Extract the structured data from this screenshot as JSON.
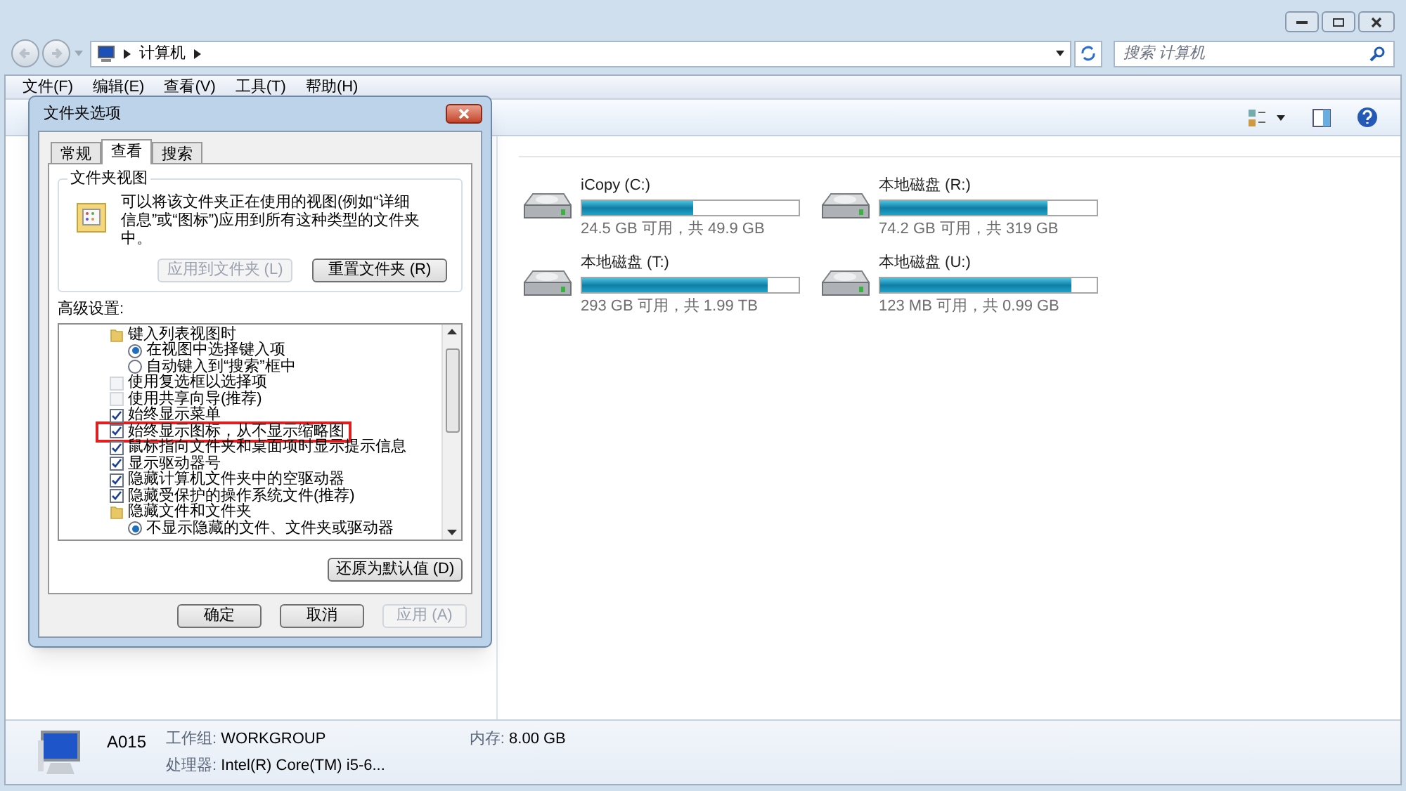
{
  "explorer": {
    "address": {
      "path": [
        "计算机"
      ]
    },
    "search": {
      "placeholder": "搜索 计算机"
    },
    "menu": [
      "文件(F)",
      "编辑(E)",
      "查看(V)",
      "工具(T)",
      "帮助(H)"
    ],
    "drives": [
      {
        "name": "iCopy (C:)",
        "level": 0.51,
        "reading": "24.5 GB 可用，共 49.9 GB"
      },
      {
        "name": "本地磁盘 (R:)",
        "level": 0.77,
        "reading": "74.2 GB 可用，共 319 GB"
      },
      {
        "name": "本地磁盘 (T:)",
        "level": 0.86,
        "reading": "293 GB 可用，共 1.99 TB"
      },
      {
        "name": "本地磁盘 (U:)",
        "level": 0.88,
        "reading": "123 MB 可用，共 0.99 GB"
      }
    ],
    "details": {
      "computer_name": "A015",
      "fields": [
        {
          "label": "工作组:",
          "value": "WORKGROUP"
        },
        {
          "label": "内存:",
          "value": "8.00 GB"
        },
        {
          "label": "处理器:",
          "value": "Intel(R) Core(TM) i5-6..."
        }
      ]
    }
  },
  "dialog": {
    "title": "文件夹选项",
    "tabs": [
      {
        "label": "常规",
        "selected": false
      },
      {
        "label": "查看",
        "selected": true
      },
      {
        "label": "搜索",
        "selected": false
      }
    ],
    "folder_views": {
      "title": "文件夹视图",
      "description": "可以将该文件夹正在使用的视图(例如“详细信息”或“图标”)应用到所有这种类型的文件夹中。",
      "buttons": [
        {
          "label": "应用到文件夹 (L)",
          "disabled": true
        },
        {
          "label": "重置文件夹 (R)",
          "disabled": false
        }
      ]
    },
    "advanced_label": "高级设置:",
    "settings": [
      {
        "kind": "folder",
        "label": "键入列表视图时",
        "children": [
          {
            "kind": "radio",
            "label": "在视图中选择键入项",
            "selected": true
          },
          {
            "kind": "radio",
            "label": "自动键入到“搜索”框中",
            "selected": false
          }
        ]
      },
      {
        "kind": "checkbox",
        "label": "使用复选框以选择项",
        "checked": false,
        "highlighted": false
      },
      {
        "kind": "checkbox",
        "label": "使用共享向导(推荐)",
        "checked": false,
        "highlighted": false
      },
      {
        "kind": "checkbox",
        "label": "始终显示菜单",
        "checked": true,
        "highlighted": false
      },
      {
        "kind": "checkbox",
        "label": "始终显示图标，从不显示缩略图",
        "checked": true,
        "highlighted": true
      },
      {
        "kind": "checkbox",
        "label": "鼠标指向文件夹和桌面项时显示提示信息",
        "checked": true,
        "highlighted": false
      },
      {
        "kind": "checkbox",
        "label": "显示驱动器号",
        "checked": true,
        "highlighted": false
      },
      {
        "kind": "checkbox",
        "label": "隐藏计算机文件夹中的空驱动器",
        "checked": true,
        "highlighted": false
      },
      {
        "kind": "checkbox",
        "label": "隐藏受保护的操作系统文件(推荐)",
        "checked": true,
        "highlighted": false
      },
      {
        "kind": "folder",
        "label": "隐藏文件和文件夹",
        "children": [
          {
            "kind": "radio",
            "label": "不显示隐藏的文件、文件夹或驱动器",
            "selected": true
          }
        ]
      }
    ],
    "restore_button": "还原为默认值 (D)",
    "footer_buttons": [
      {
        "label": "确定",
        "disabled": false
      },
      {
        "label": "取消",
        "disabled": false
      },
      {
        "label": "应用 (A)",
        "disabled": true
      }
    ]
  }
}
